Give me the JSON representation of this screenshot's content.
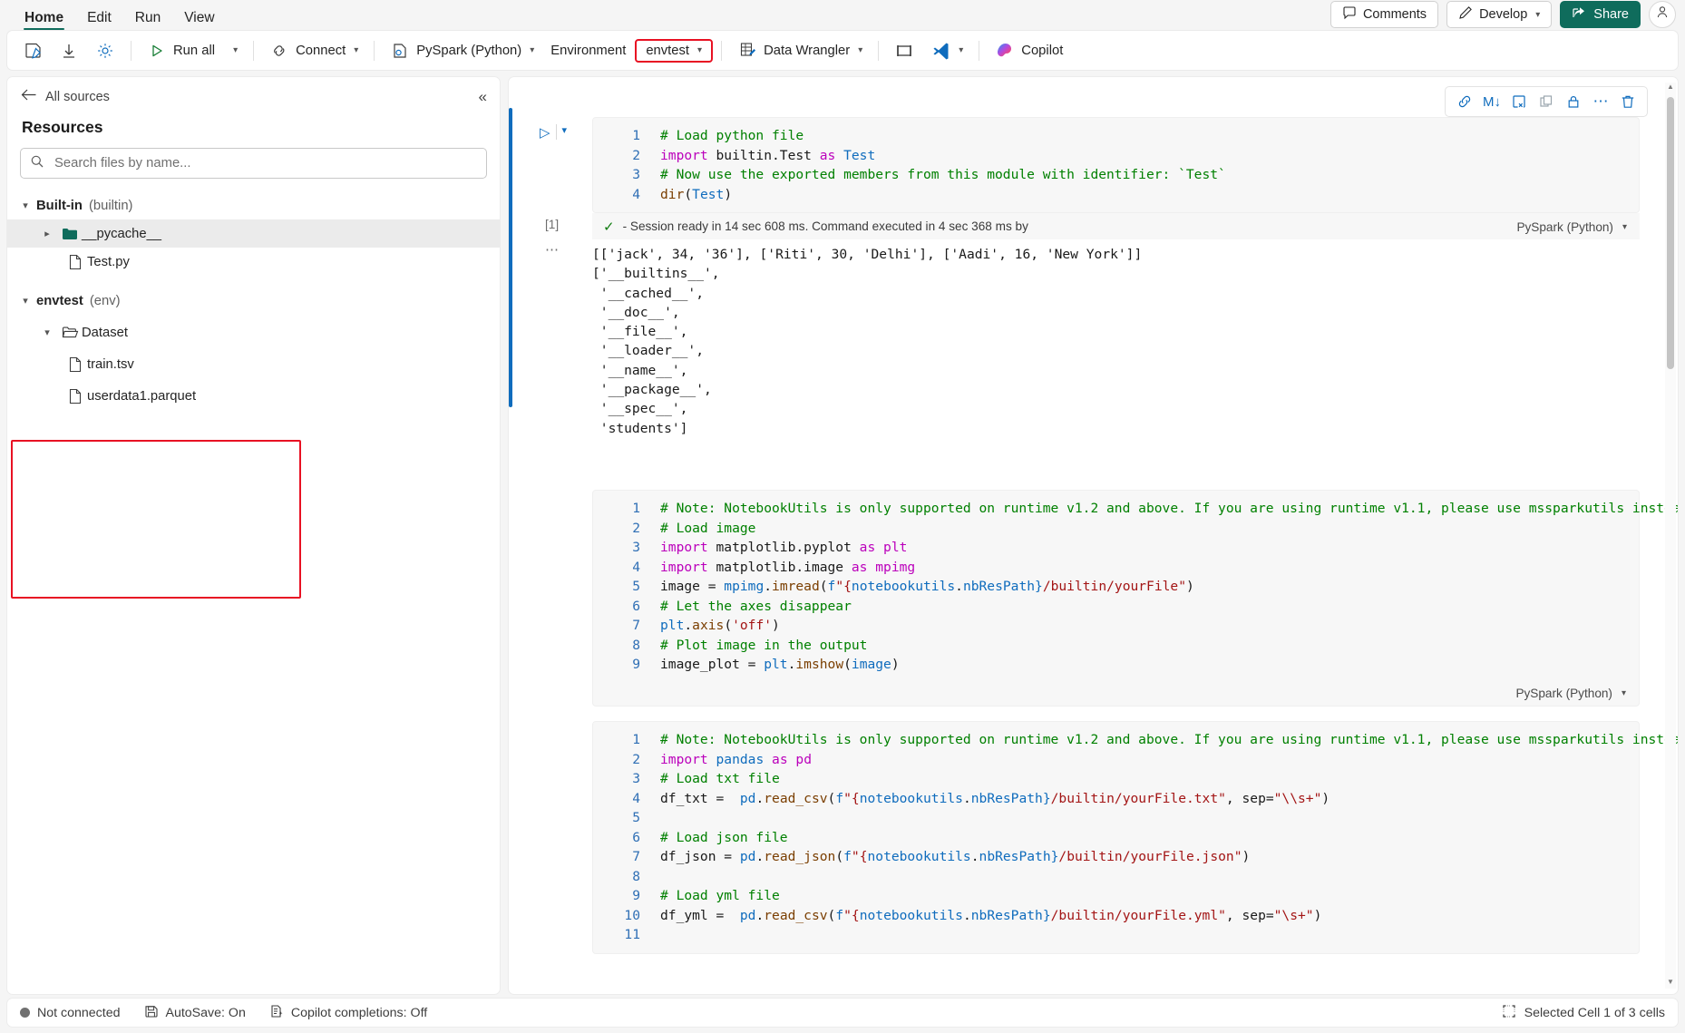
{
  "ribbon": {
    "tabs": [
      {
        "label": "Home",
        "active": true
      },
      {
        "label": "Edit",
        "active": false
      },
      {
        "label": "Run",
        "active": false
      },
      {
        "label": "View",
        "active": false
      }
    ],
    "comments_label": "Comments",
    "develop_label": "Develop",
    "share_label": "Share"
  },
  "toolbar": {
    "run_all_label": "Run all",
    "connect_label": "Connect",
    "kernel_label": "PySpark (Python)",
    "environment_label": "Environment",
    "env_name": "envtest",
    "data_wrangler_label": "Data Wrangler",
    "copilot_label": "Copilot"
  },
  "sidebar": {
    "back_label": "All sources",
    "title": "Resources",
    "search_placeholder": "Search files by name...",
    "search_value": "",
    "tree": [
      {
        "label": "Built-in",
        "sub": "(builtin)",
        "icon": "chevron-down-icon",
        "indent": 0,
        "bold": true,
        "type": "group"
      },
      {
        "label": "__pycache__",
        "sub": "",
        "icon": "folder-filled-icon",
        "indent": 1,
        "bold": false,
        "type": "folder",
        "selected": true
      },
      {
        "label": "Test.py",
        "sub": "",
        "icon": "file-icon",
        "indent": 2,
        "bold": false,
        "type": "file"
      },
      {
        "label": "envtest",
        "sub": "(env)",
        "icon": "chevron-down-icon",
        "indent": 0,
        "bold": true,
        "type": "group"
      },
      {
        "label": "Dataset",
        "sub": "",
        "icon": "folder-open-icon",
        "indent": 1,
        "bold": false,
        "type": "folder"
      },
      {
        "label": "train.tsv",
        "sub": "",
        "icon": "file-icon",
        "indent": 2,
        "bold": false,
        "type": "file"
      },
      {
        "label": "userdata1.parquet",
        "sub": "",
        "icon": "file-icon",
        "indent": 2,
        "bold": false,
        "type": "file"
      }
    ]
  },
  "cell_toolbar": {
    "buttons": [
      "link-cell-icon",
      "markdown-convert-icon",
      "clear-output-icon",
      "duplicate-icon",
      "lock-icon",
      "more-options-icon",
      "delete-icon"
    ]
  },
  "notebook": {
    "cells": [
      {
        "index": 1,
        "active": true,
        "lines": [
          "# Load python file",
          "import builtin.Test as Test",
          "# Now use the exported members from this module with identifier: `Test`",
          "dir(Test)"
        ],
        "exec_count": "[1]",
        "status_text": "- Session ready in 14 sec 608 ms. Command executed in 4 sec 368 ms by",
        "language": "PySpark (Python)",
        "output": "[['jack', 34, '36'], ['Riti', 30, 'Delhi'], ['Aadi', 16, 'New York']]\n['__builtins__',\n '__cached__',\n '__doc__',\n '__file__',\n '__loader__',\n '__name__',\n '__package__',\n '__spec__',\n 'students']"
      },
      {
        "index": 2,
        "active": false,
        "lines": [
          "# Note: NotebookUtils is only supported on runtime v1.2 and above. If you are using runtime v1.1, please use mssparkutils instead.",
          "# Load image",
          "import matplotlib.pyplot as plt",
          "import matplotlib.image as mpimg",
          "image = mpimg.imread(f\"{notebookutils.nbResPath}/builtin/yourFile\")",
          "# Let the axes disappear",
          "plt.axis('off')",
          "# Plot image in the output",
          "image_plot = plt.imshow(image)"
        ],
        "language": "PySpark (Python)"
      },
      {
        "index": 3,
        "active": false,
        "lines": [
          "# Note: NotebookUtils is only supported on runtime v1.2 and above. If you are using runtime v1.1, please use mssparkutils instead.",
          "import pandas as pd",
          "# Load txt file",
          "df_txt =  pd.read_csv(f\"{notebookutils.nbResPath}/builtin/yourFile.txt\", sep=\"\\\\s+\")",
          "",
          "# Load json file",
          "df_json = pd.read_json(f\"{notebookutils.nbResPath}/builtin/yourFile.json\")",
          "",
          "# Load yml file",
          "df_yml =  pd.read_csv(f\"{notebookutils.nbResPath}/builtin/yourFile.yml\", sep=\"\\s+\")",
          ""
        ],
        "language": ""
      }
    ]
  },
  "statusbar": {
    "connection": "Not connected",
    "autosave": "AutoSave: On",
    "copilot": "Copilot completions: Off",
    "selection": "Selected Cell 1 of 3 cells"
  },
  "colors": {
    "accent": "#0f6c5c",
    "link": "#0f6cbd",
    "highlight_red": "#e81123",
    "comment_green": "#008000",
    "keyword_magenta": "#bb00bb",
    "string_red": "#a31515"
  }
}
